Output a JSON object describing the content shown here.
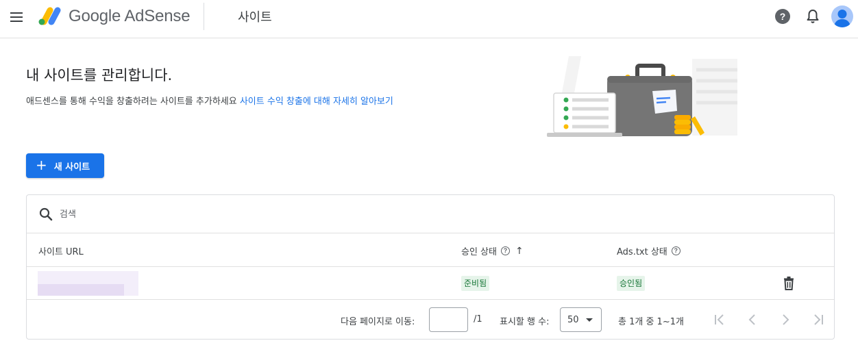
{
  "topbar": {
    "product_name": "Google AdSense",
    "page_title": "사이트",
    "help_glyph": "?"
  },
  "hero": {
    "title": "내 사이트를 관리합니다.",
    "subtitle": "애드센스를 통해 수익을 창출하려는 사이트를 추가하세요",
    "learn_more_link": "사이트 수익 창출에 대해 자세히 알아보기"
  },
  "actions": {
    "plus_glyph": "+",
    "new_site_label": "새 사이트"
  },
  "table": {
    "search_placeholder": "검색",
    "columns": {
      "url": "사이트 URL",
      "approval": "승인 상태",
      "adstxt": "Ads.txt 상태"
    },
    "sort_glyph": "↑",
    "help_glyph": "?",
    "rows": [
      {
        "approval_status": "준비됨",
        "adstxt_status": "승인됨"
      }
    ],
    "status_color": "#137333",
    "status_bg": "#e6f4ea"
  },
  "pagination": {
    "goto_label": "다음 페이지로 이동:",
    "page_value": "",
    "page_total": "/1",
    "rows_label": "표시할 행 수:",
    "rows_value": "50",
    "range_text": "총 1개 중 1~1개"
  },
  "colors": {
    "accent": "#1a73e8",
    "logo_yellow": "#fbbc04",
    "logo_blue": "#4285f4",
    "logo_green": "#34a853"
  },
  "icons": {
    "menu": "menu-icon",
    "help": "help-circle-icon",
    "notifications": "bell-icon",
    "account": "avatar-icon",
    "search": "search-icon",
    "delete": "trash-icon",
    "first": "first-page-icon",
    "prev": "chevron-left-icon",
    "next": "chevron-right-icon",
    "last": "last-page-icon"
  }
}
